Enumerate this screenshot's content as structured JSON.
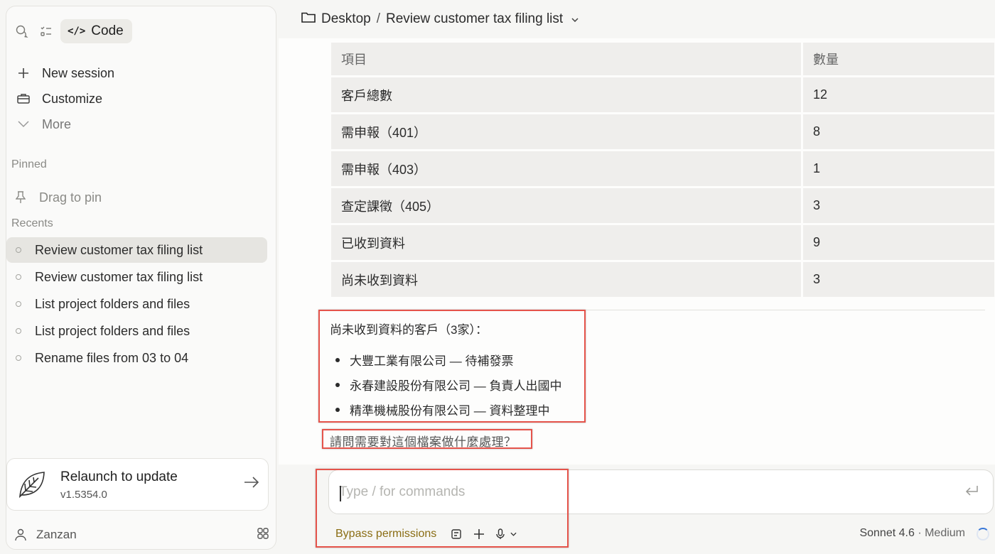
{
  "sidebar": {
    "code_tab_label": "Code",
    "nav": {
      "new_session": "New session",
      "customize": "Customize",
      "more": "More"
    },
    "pinned_label": "Pinned",
    "drag_to_pin": "Drag to pin",
    "recents_label": "Recents",
    "recents": [
      {
        "label": "Review customer tax filing list",
        "active": true
      },
      {
        "label": "Review customer tax filing list",
        "active": false
      },
      {
        "label": "List project folders and files",
        "active": false
      },
      {
        "label": "List project folders and files",
        "active": false
      },
      {
        "label": "Rename files from 03 to 04",
        "active": false
      }
    ],
    "update": {
      "title": "Relaunch to update",
      "version": "v1.5354.0"
    },
    "user": "Zanzan"
  },
  "breadcrumb": {
    "folder": "Desktop",
    "separator": "/",
    "session": "Review customer tax filing list"
  },
  "table": {
    "headers": [
      "項目",
      "數量"
    ],
    "rows": [
      [
        "客戶總數",
        "12"
      ],
      [
        "需申報（401）",
        "8"
      ],
      [
        "需申報（403）",
        "1"
      ],
      [
        "查定課徵（405）",
        "3"
      ],
      [
        "已收到資料",
        "9"
      ],
      [
        "尚未收到資料",
        "3"
      ]
    ]
  },
  "summary": {
    "title": "尚未收到資料的客戶（3家）：",
    "items": [
      "大豐工業有限公司 — 待補發票",
      "永春建設股份有限公司 — 負責人出國中",
      "精準機械股份有限公司 — 資料整理中"
    ],
    "question": "請問需要對這個檔案做什麼處理？"
  },
  "composer": {
    "placeholder": "Type / for commands",
    "value": "",
    "bypass_label": "Bypass permissions",
    "model": "Sonnet 4.6",
    "model_sep": "·",
    "effort": "Medium"
  },
  "colors": {
    "highlight": "#e5544b",
    "bypass": "#8a6d14",
    "active_row": "#e6e5e1"
  }
}
